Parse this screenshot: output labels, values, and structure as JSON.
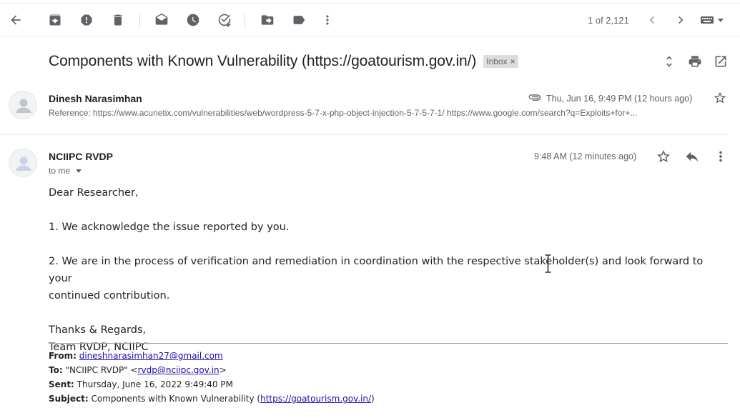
{
  "toolbar": {
    "icons": [
      "back-arrow-icon",
      "archive-icon",
      "report-spam-icon",
      "delete-icon",
      "mark-unread-icon",
      "snooze-icon",
      "add-task-icon",
      "move-to-icon",
      "label-icon",
      "more-vert-icon"
    ],
    "pager": "1 of 2,121",
    "pager_icons": [
      "chevron-left-icon",
      "chevron-right-icon",
      "keyboard-icon"
    ]
  },
  "thread": {
    "subject": "Components with Known Vulnerability (https://goatourism.gov.in/)",
    "label": "Inbox",
    "label_remove": "×",
    "icons": [
      "expand-all-icon",
      "print-icon",
      "open-in-new-window-icon"
    ]
  },
  "message1": {
    "sender": "Dinesh Narasimhan",
    "date": "Thu, Jun 16, 9:49 PM (12 hours ago)",
    "snippet": "Reference: https://www.acunetix.com/vulnerabilities/web/wordpress-5-7-x-php-object-injection-5-7-5-7-1/ https://www.google.com/search?q=Exploits+for+...",
    "icons": [
      "attachment-icon",
      "star-icon"
    ]
  },
  "message2": {
    "sender": "NCIIPC RVDP",
    "to": "to me",
    "time": "9:48 AM (12 minutes ago)",
    "icons": [
      "star-icon",
      "reply-icon",
      "more-vert-icon"
    ],
    "body": {
      "greeting": "Dear Researcher,",
      "line1": "1. We acknowledge the issue reported by you.",
      "line2a": "2. We are in the process of verification and remediation in coordination with the respective stakeholder(s) and look forward to your",
      "line2b": "continued contribution.",
      "signoff1": "Thanks & Regards,",
      "signoff2": "Team RVDP, NCIIPC"
    },
    "quoted": {
      "from_label": "From:",
      "from_value": "dineshnarasimhan27@gmail.com",
      "to_label": "To:",
      "to_prefix": "\"NCIIPC RVDP\" <",
      "to_email": "rvdp@nciipc.gov.in",
      "to_suffix": ">",
      "sent_label": "Sent:",
      "sent_value": "Thursday, June 16, 2022 9:49:40 PM",
      "subject_label": "Subject:",
      "subject_prefix": "Components with Known Vulnerability (",
      "subject_link": "https://goatourism.gov.in/",
      "subject_suffix": ")"
    }
  },
  "colors": {
    "icon_gray": "#5f6368",
    "link_blue": "#1a0dab",
    "label_chip": "#dddddd"
  }
}
